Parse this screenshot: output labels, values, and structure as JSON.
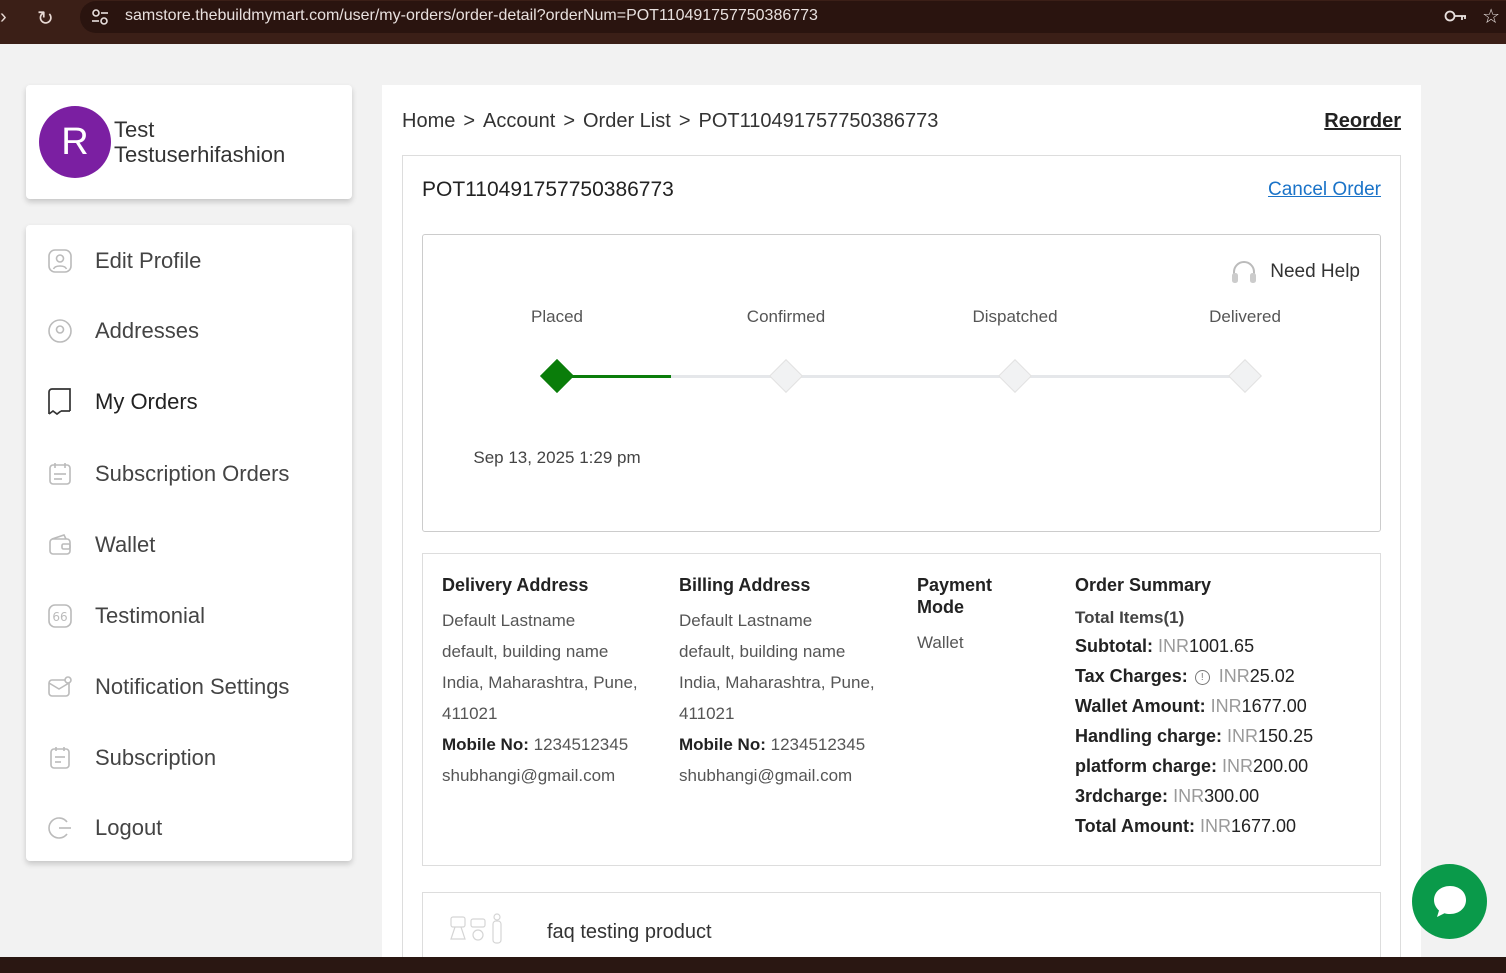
{
  "browser": {
    "url": "samstore.thebuildmymart.com/user/my-orders/order-detail?orderNum=POT110491757750386773"
  },
  "profile": {
    "avatar_letter": "R",
    "first_name": "Test",
    "last_name": "Testuserhifashion"
  },
  "sidebar": {
    "items": [
      {
        "label": "Edit Profile",
        "icon": "user-icon"
      },
      {
        "label": "Addresses",
        "icon": "location-pin-icon"
      },
      {
        "label": "My Orders",
        "icon": "receipt-icon"
      },
      {
        "label": "Subscription Orders",
        "icon": "calendar-list-icon"
      },
      {
        "label": "Wallet",
        "icon": "wallet-icon"
      },
      {
        "label": "Testimonial",
        "icon": "quote-icon"
      },
      {
        "label": "Notification Settings",
        "icon": "mail-notification-icon"
      },
      {
        "label": "Subscription",
        "icon": "subscription-icon"
      },
      {
        "label": "Logout",
        "icon": "logout-icon"
      }
    ]
  },
  "breadcrumb": {
    "home": "Home",
    "account": "Account",
    "order_list": "Order List",
    "current": "POT110491757750386773",
    "separator": ">"
  },
  "actions": {
    "reorder": "Reorder",
    "cancel_order": "Cancel Order",
    "need_help": "Need Help"
  },
  "order": {
    "number": "POT110491757750386773",
    "steps": [
      {
        "label": "Placed",
        "done": true
      },
      {
        "label": "Confirmed",
        "done": false
      },
      {
        "label": "Dispatched",
        "done": false
      },
      {
        "label": "Delivered",
        "done": false
      }
    ],
    "placed_date": "Sep 13, 2025 1:29 pm"
  },
  "delivery_address": {
    "title": "Delivery Address",
    "name": "Default Lastname",
    "line1": "default, building name",
    "line2": "India, Maharashtra, Pune,",
    "pincode": "411021",
    "mobile_label": "Mobile No:",
    "mobile": "1234512345",
    "email": "shubhangi@gmail.com"
  },
  "billing_address": {
    "title": "Billing Address",
    "name": "Default Lastname",
    "line1": "default, building name",
    "line2": "India, Maharashtra, Pune,",
    "pincode": "411021",
    "mobile_label": "Mobile No:",
    "mobile": "1234512345",
    "email": "shubhangi@gmail.com"
  },
  "payment": {
    "title_line1": "Payment",
    "title_line2": "Mode",
    "mode": "Wallet"
  },
  "summary": {
    "title": "Order Summary",
    "total_items": "Total Items(1)",
    "currency": "INR",
    "rows": [
      {
        "label": "Subtotal:",
        "amount": "1001.65"
      },
      {
        "label": "Tax Charges:",
        "amount": "25.02"
      },
      {
        "label": "Wallet Amount:",
        "amount": "1677.00"
      },
      {
        "label": "Handling charge:",
        "amount": "150.25"
      },
      {
        "label": "platform charge:",
        "amount": "200.00"
      },
      {
        "label": "3rdcharge:",
        "amount": "300.00"
      },
      {
        "label": "Total Amount:",
        "amount": "1677.00"
      }
    ]
  },
  "product": {
    "name": "faq testing product"
  },
  "colors": {
    "avatar": "#7b1fa2",
    "progress_done": "#0a7d0a",
    "link": "#1a73c8",
    "chat": "#0a9a4a"
  }
}
